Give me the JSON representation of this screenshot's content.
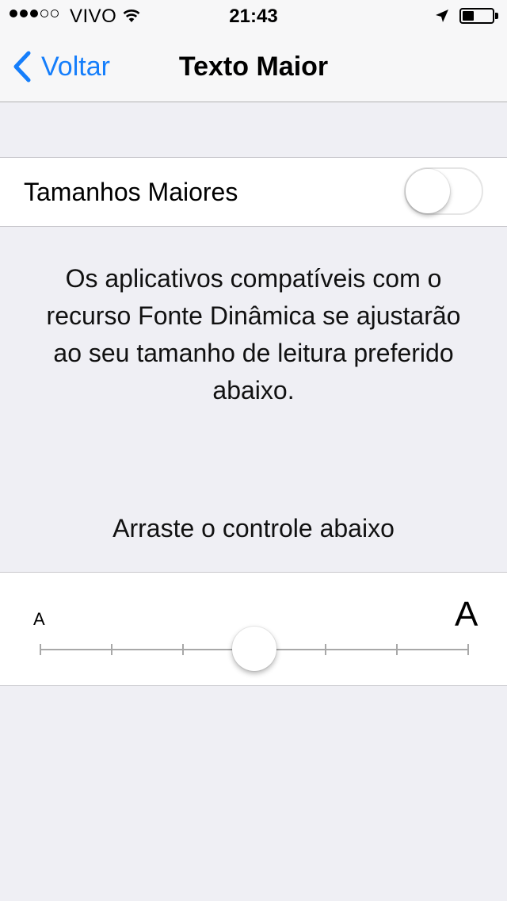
{
  "status_bar": {
    "carrier": "VIVO",
    "time": "21:43",
    "signal_dots_filled": 3,
    "signal_dots_total": 5
  },
  "nav": {
    "back_label": "Voltar",
    "title": "Texto Maior"
  },
  "larger_sizes": {
    "label": "Tamanhos Maiores",
    "enabled": false
  },
  "description": "Os aplicativos compatíveis com o recurso Fonte Dinâmica se ajustarão ao seu tamanho de leitura preferido abaixo.",
  "instruction": "Arraste o controle abaixo",
  "text_size_slider": {
    "small_label": "A",
    "large_label": "A",
    "steps": 7,
    "selected_index": 3
  },
  "colors": {
    "accent": "#157efb",
    "background": "#efeff4"
  }
}
